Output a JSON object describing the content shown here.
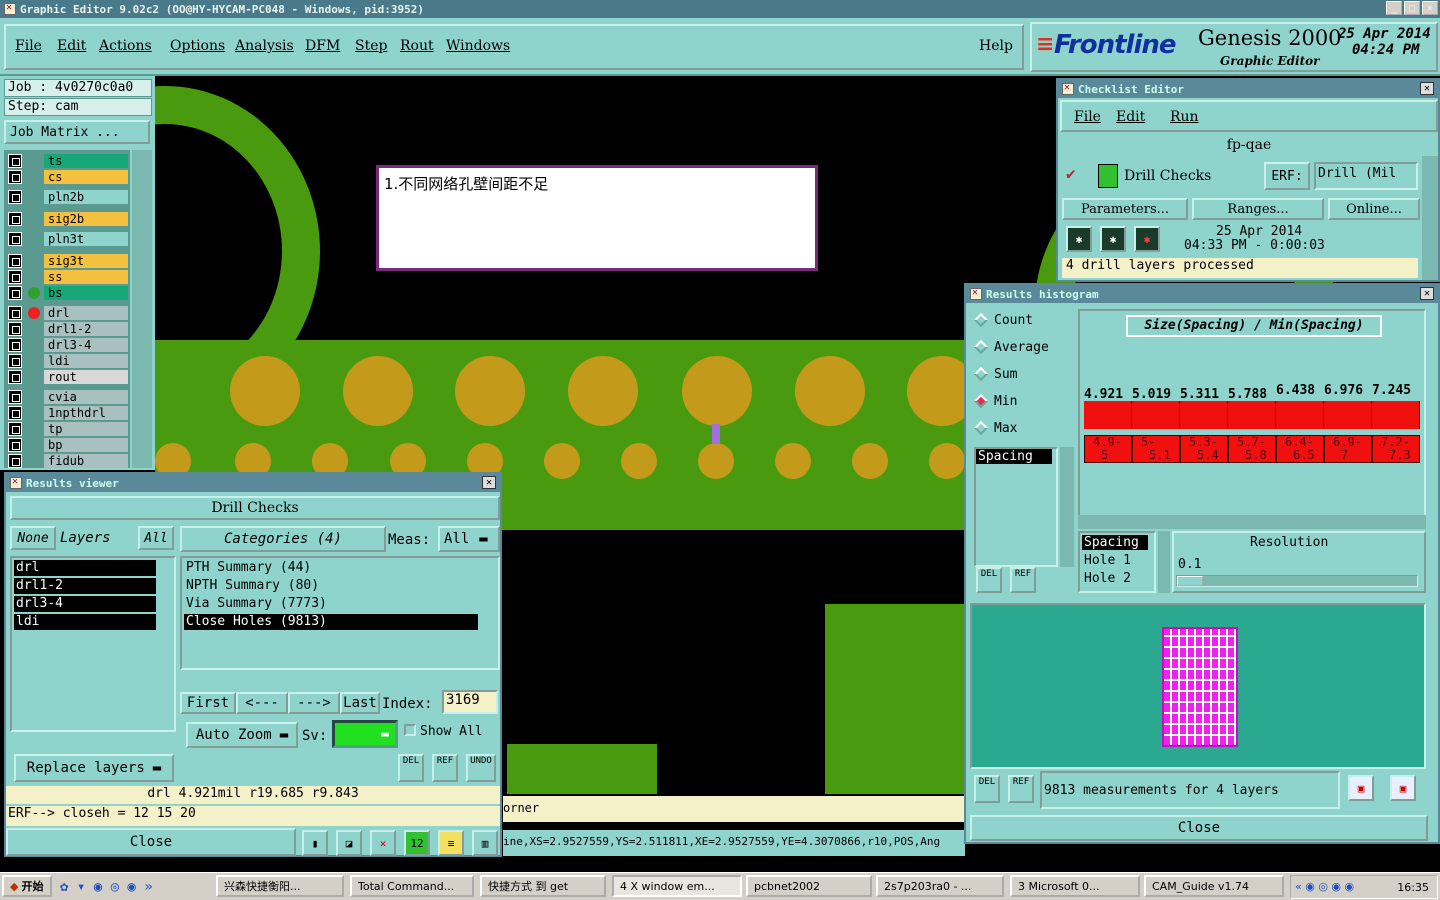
{
  "window": {
    "title": "Graphic Editor 9.02c2 (OO@HY-HYCAM-PC048 - Windows, pid:3952)"
  },
  "menu": [
    "File",
    "Edit",
    "Actions",
    "Options",
    "Analysis",
    "DFM",
    "Step",
    "Rout",
    "Windows"
  ],
  "help": "Help",
  "brand": {
    "logo": "Frontline",
    "product": "Genesis 2000",
    "subtitle": "Graphic Editor",
    "date": "25 Apr 2014",
    "time": "04:24 PM"
  },
  "job": {
    "job": "Job : 4v0270c0a0",
    "step": "Step: cam",
    "matrix": "Job Matrix ..."
  },
  "layers": [
    {
      "name": "ts",
      "color": "#18a878"
    },
    {
      "name": "cs",
      "color": "#f4c040"
    },
    {
      "name": "pln2b",
      "color": "#8fd4cc"
    },
    {
      "name": "sig2b",
      "color": "#f4c040"
    },
    {
      "name": "pln3t",
      "color": "#8fd4cc"
    },
    {
      "name": "sig3t",
      "color": "#f4c040"
    },
    {
      "name": "ss",
      "color": "#f4c040"
    },
    {
      "name": "bs",
      "color": "#18a878"
    },
    {
      "name": "drl",
      "color": "#a8c0c0"
    },
    {
      "name": "drl1-2",
      "color": "#a8c0c0"
    },
    {
      "name": "drl3-4",
      "color": "#a8c0c0"
    },
    {
      "name": "ldi",
      "color": "#a8c0c0"
    },
    {
      "name": "rout",
      "color": "#d8d8d8"
    },
    {
      "name": "cvia",
      "color": "#a8c0c0"
    },
    {
      "name": "1npthdrl",
      "color": "#a8c0c0"
    },
    {
      "name": "tp",
      "color": "#a8c0c0"
    },
    {
      "name": "bp",
      "color": "#a8c0c0"
    },
    {
      "name": "fidub",
      "color": "#a8c0c0"
    }
  ],
  "note": "1.不同网络孔壁间距不足",
  "results_viewer": {
    "title": "Results viewer",
    "header": "Drill Checks",
    "none": "None",
    "layers_label": "Layers",
    "all": "All",
    "categories_label": "Categories (4)",
    "meas_label": "Meas:",
    "meas_value": "All",
    "layer_list": [
      "drl",
      "drl1-2",
      "drl3-4",
      "ldi"
    ],
    "categories": [
      "PTH Summary (44)",
      "NPTH Summary (80)",
      "Via Summary (7773)",
      "Close Holes (9813)"
    ],
    "first": "First",
    "prev": "<---",
    "next": "--->",
    "last": "Last",
    "index_label": "Index:",
    "index_value": "3169",
    "auto_zoom": "Auto Zoom",
    "sv_label": "Sv:",
    "show_all": "Show All",
    "replace_layers": "Replace layers",
    "status1": "drl  4.921mil   r19.685   r9.843",
    "status2": "ERF--> closeh = 12 15 20",
    "close": "Close",
    "del": "DEL",
    "ref": "REF",
    "undo": "UNDO"
  },
  "checklist": {
    "title": "Checklist Editor",
    "menu": [
      "File",
      "Edit",
      "Run"
    ],
    "name": "fp-qae",
    "check": "Drill Checks",
    "erf_label": "ERF:",
    "erf_value": "Drill (Mil",
    "parameters": "Parameters...",
    "ranges": "Ranges...",
    "online": "Online...",
    "date": "25 Apr 2014",
    "time": "04:33 PM - 0:00:03",
    "status": "4 drill layers processed"
  },
  "histogram": {
    "title": "Results histogram",
    "options": [
      "Count",
      "Average",
      "Sum",
      "Min",
      "Max"
    ],
    "selected": "Min",
    "heading": "Size(Spacing) / Min(Spacing)",
    "metric_list": [
      "Spacing"
    ],
    "bars": [
      {
        "value": "4.921",
        "range1": "4.9-",
        "range2": "5"
      },
      {
        "value": "5.019",
        "range1": "5-",
        "range2": "5.1"
      },
      {
        "value": "5.311",
        "range1": "5.3-",
        "range2": "5.4"
      },
      {
        "value": "5.788",
        "range1": "5.7-",
        "range2": "5.8"
      },
      {
        "value": "6.438",
        "range1": "6.4-",
        "range2": "6.5"
      },
      {
        "value": "6.976",
        "range1": "6.9-",
        "range2": "7"
      },
      {
        "value": "7.245",
        "range1": "7.2-",
        "range2": "7.3"
      }
    ],
    "fields": [
      "Spacing",
      "Hole 1",
      "Hole 2"
    ],
    "resolution_label": "Resolution",
    "resolution_value": "0.1",
    "measurements": "9813 measurements for 4 layers",
    "close": "Close",
    "del": "DEL",
    "ref": "REF"
  },
  "canvas": {
    "cmd_fragment": "orner",
    "coords": "ine,XS=2.9527559,YS=2.511811,XE=2.9527559,YE=4.3070866,r10,POS,Ang"
  },
  "taskbar": {
    "start": "开始",
    "items": [
      "兴森快捷衡阳...",
      "Total Command...",
      "快捷方式 到 get",
      "4 X window em...",
      "pcbnet2002",
      "2s7p203ra0 - ...",
      "3 Microsoft 0...",
      "CAM_Guide v1.74"
    ],
    "clock": "16:35"
  }
}
